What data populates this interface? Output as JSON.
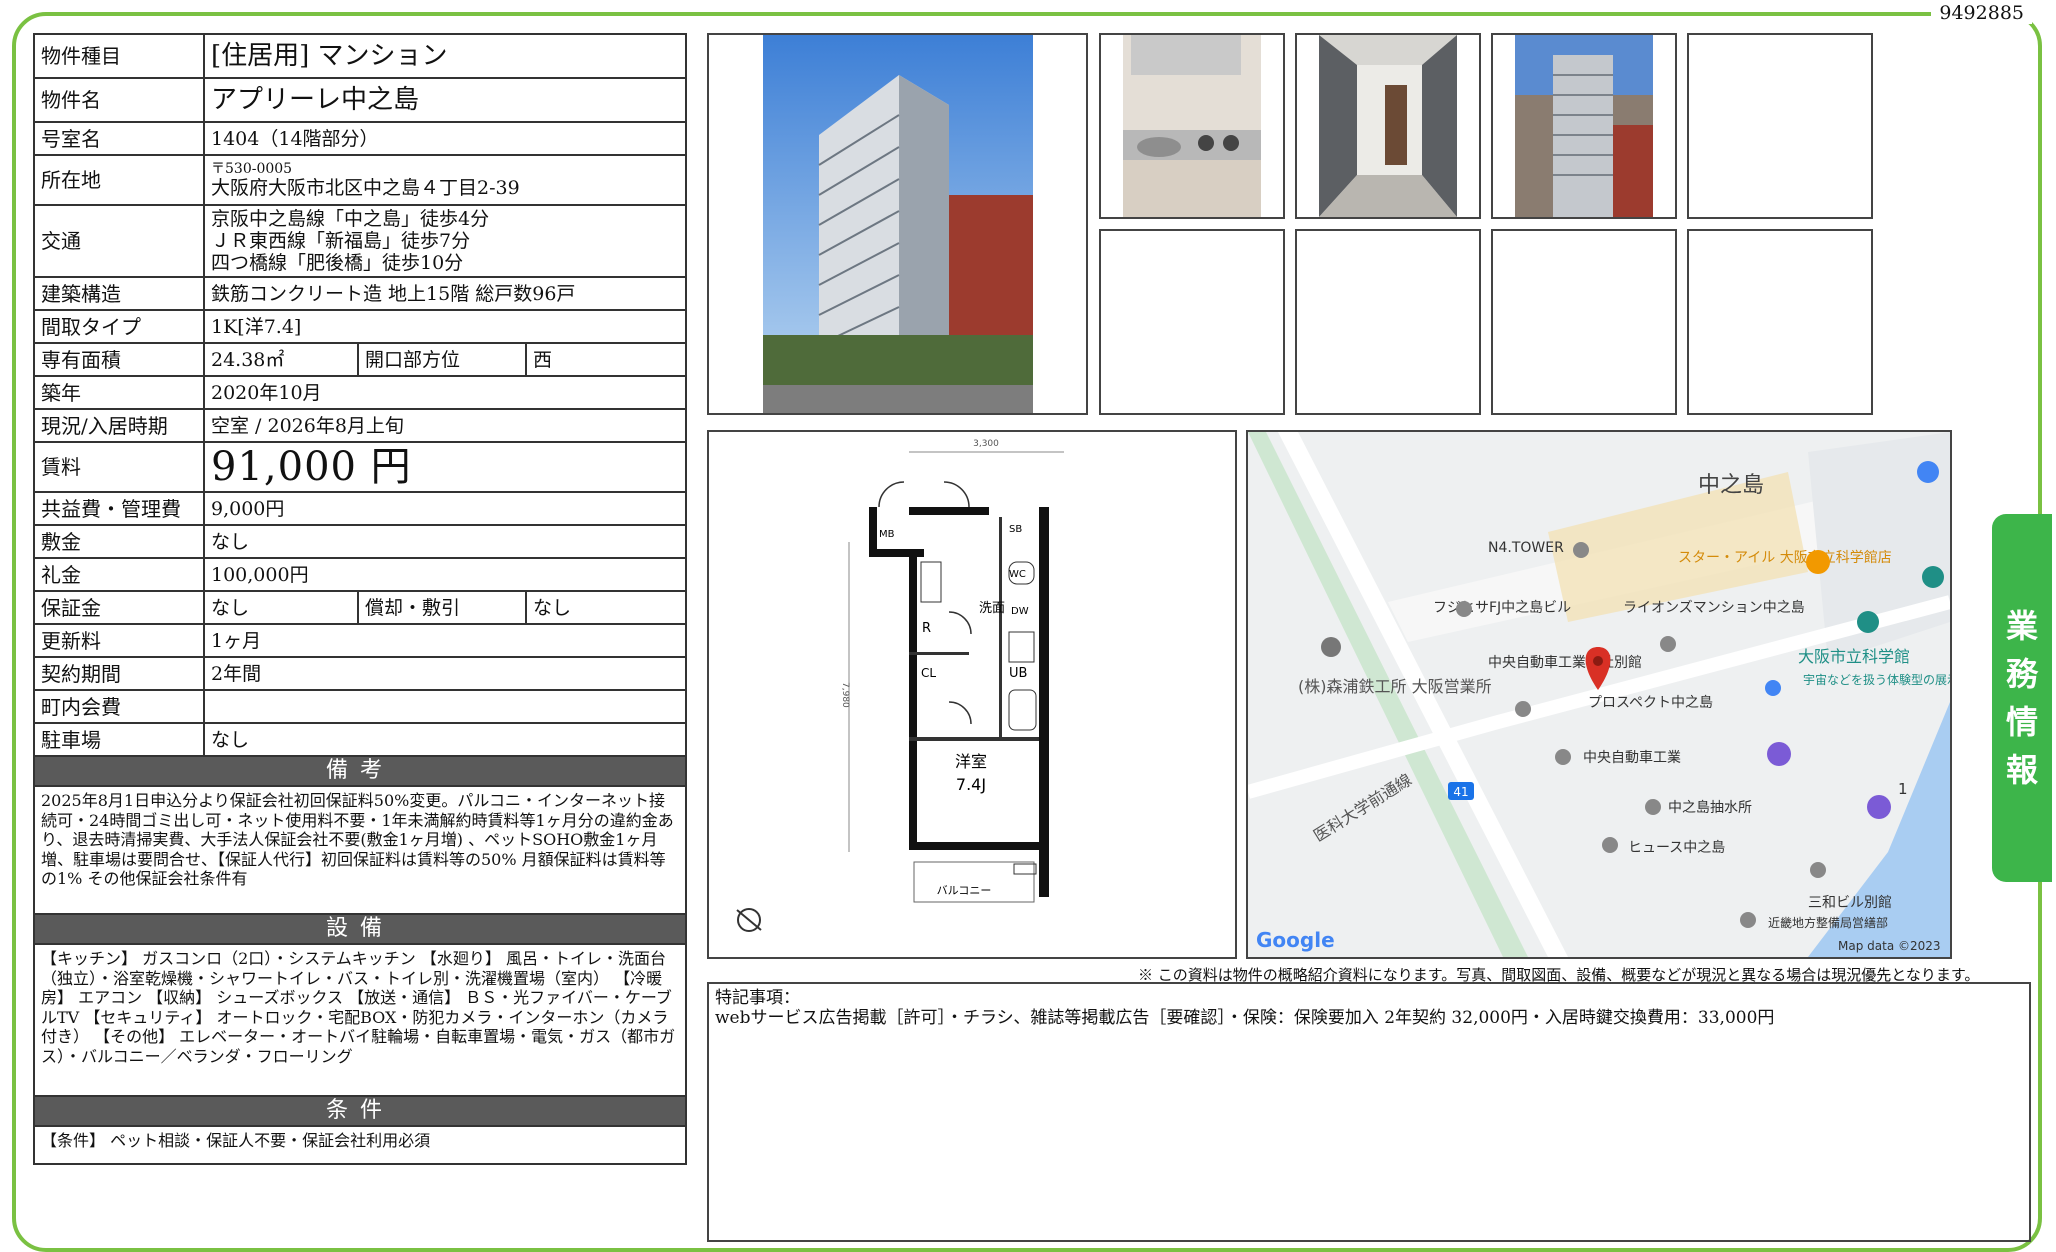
{
  "doc_id": "9492885",
  "side_tab": "業務情報",
  "spec": {
    "type_label": "物件種目",
    "type_value": "[住居用] マンション",
    "name_label": "物件名",
    "name_value": "アプリーレ中之島",
    "room_label": "号室名",
    "room_value": "1404（14階部分）",
    "address_label": "所在地",
    "postal": "〒530-0005",
    "address": "大阪府大阪市北区中之島４丁目2-39",
    "transport_label": "交通",
    "transport_lines": [
      "京阪中之島線「中之島」徒歩4分",
      "ＪＲ東西線「新福島」徒歩7分",
      "四つ橋線「肥後橋」徒歩10分"
    ],
    "structure_label": "建築構造",
    "structure_value": "鉄筋コンクリート造 地上15階 総戸数96戸",
    "layout_label": "間取タイプ",
    "layout_value": "1K[洋7.4]",
    "area_label": "専有面積",
    "area_value": "24.38㎡",
    "direction_label": "開口部方位",
    "direction_value": "西",
    "built_label": "築年",
    "built_value": "2020年10月",
    "status_label": "現況/入居時期",
    "status_value": "空室 / 2026年8月上旬",
    "rent_label": "賃料",
    "rent_value": "91,000 円",
    "fee_label": "共益費・管理費",
    "fee_value": "9,000円",
    "deposit_label": "敷金",
    "deposit_value": "なし",
    "key_money_label": "礼金",
    "key_money_value": "100,000円",
    "guarantee_label": "保証金",
    "guarantee_value": "なし",
    "amort_label": "償却・敷引",
    "amort_value": "なし",
    "renewal_label": "更新料",
    "renewal_value": "1ヶ月",
    "contract_label": "契約期間",
    "contract_value": "2年間",
    "association_label": "町内会費",
    "association_value": "",
    "parking_label": "駐車場",
    "parking_value": "なし"
  },
  "remarks": {
    "heading": "備考",
    "text": "2025年8月1日申込分より保証会社初回保証料50%変更。パルコニ・インターネット接続可・24時間ゴミ出し可・ネット使用料不要・1年未満解約時賃料等1ヶ月分の違約金あり、退去時清掃実費、大手法人保証会社不要(敷金1ヶ月増) 、ペットSOHO敷金1ヶ月増、駐車場は要問合せ、【保証人代行】初回保証料は賃料等の50% 月額保証料は賃料等の1% その他保証会社条件有"
  },
  "facilities": {
    "heading": "設備",
    "text": "【キッチン】 ガスコンロ（2口）・システムキッチン 【水廻り】 風呂・トイレ・洗面台（独立）・浴室乾燥機・シャワートイレ・バス・トイレ別・洗濯機置場（室内） 【冷暖房】 エアコン 【収納】 シューズボックス 【放送・通信】 ＢＳ・光ファイバー・ケーブルTV 【セキュリティ】 オートロック・宅配BOX・防犯カメラ・インターホン（カメラ付き） 【その他】 エレベーター・オートバイ駐輪場・自転車置場・電気・ガス（都市ガス）・バルコニー／ベランダ・フローリング"
  },
  "conditions": {
    "heading": "条件",
    "text": "【条件】 ペット相談・保証人不要・保証会社利用必須"
  },
  "floorplan": {
    "dim_top": "3,300",
    "dim_side": "7,980",
    "room_name": "洋室",
    "room_size": "7.4J",
    "balcony": "バルコニー",
    "labels": [
      "MB",
      "SB",
      "WC",
      "R",
      "洗面",
      "DW",
      "CL",
      "UB"
    ]
  },
  "map": {
    "area_label": "中之島",
    "pois": [
      "N4.TOWER",
      "スター・アイル 大阪市立科学館店",
      "フジヒサFJ中之島ビル",
      "ライオンズマンション中之島",
      "中央自動車工業本社別館",
      "プロスペクト中之島",
      "大阪市立科学館",
      "宇宙などを扱う体験型の展示",
      "(株)森浦鉄工所 大阪営業所",
      "中央自動車工業",
      "中之島抽水所",
      "ヒュース中之島",
      "三和ビル別館",
      "近畿地方整備局営繕部"
    ],
    "road_name": "医科大学前通線",
    "route": "41",
    "marker_1": "1",
    "google": "Google",
    "copyright": "Map data ©2023"
  },
  "disclaimer": "※ この資料は物件の概略紹介資料になります。写真、間取図面、設備、概要などが現況と異なる場合は現況優先となります。",
  "special_notes": {
    "heading": "特記事項：",
    "text": "webサービス広告掲載［許可］・チラシ、雑誌等掲載広告［要確認］・保険：保険要加入 2年契約 32,000円・入居時鍵交換費用：33,000円"
  }
}
